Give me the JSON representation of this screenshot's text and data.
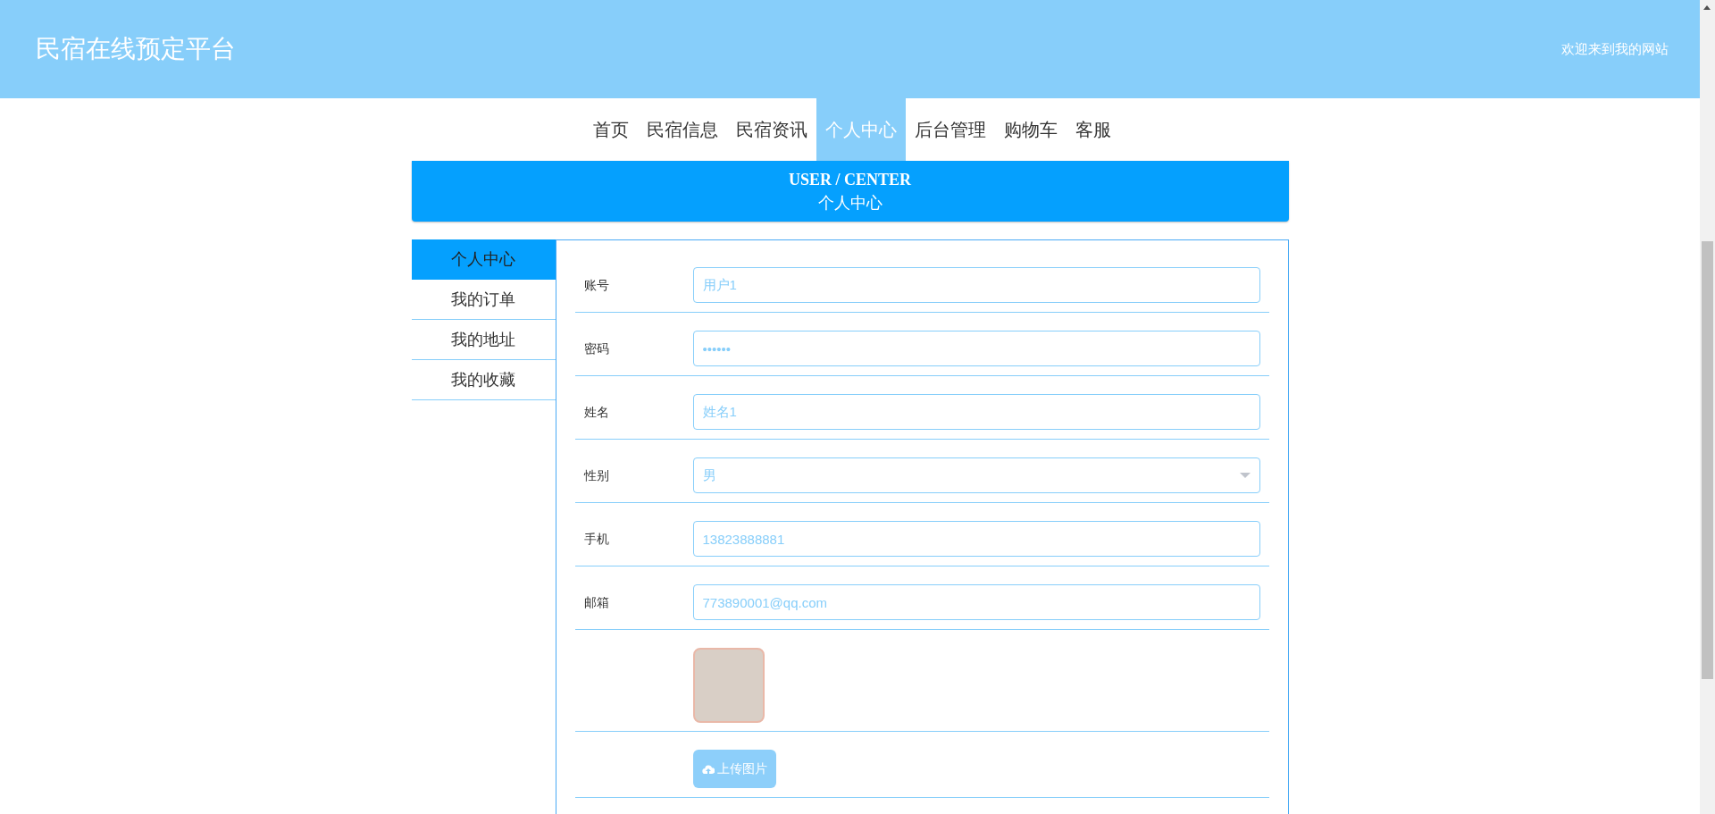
{
  "header": {
    "title": "民宿在线预定平台",
    "welcome": "欢迎来到我的网站"
  },
  "nav": [
    {
      "label": "首页",
      "selected": false
    },
    {
      "label": "民宿信息",
      "selected": false
    },
    {
      "label": "民宿资讯",
      "selected": false
    },
    {
      "label": "个人中心",
      "selected": true
    },
    {
      "label": "后台管理",
      "selected": false
    },
    {
      "label": "购物车",
      "selected": false
    },
    {
      "label": "客服",
      "selected": false
    }
  ],
  "banner": {
    "subtitle": "USER / CENTER",
    "title": "个人中心"
  },
  "sidebar": {
    "items": [
      {
        "label": "个人中心",
        "selected": true
      },
      {
        "label": "我的订单",
        "selected": false
      },
      {
        "label": "我的地址",
        "selected": false
      },
      {
        "label": "我的收藏",
        "selected": false
      }
    ]
  },
  "form": {
    "rows": [
      {
        "kind": "text",
        "label": "账号",
        "value": "用户1"
      },
      {
        "kind": "text",
        "label": "密码",
        "value": "••••••"
      },
      {
        "kind": "text",
        "label": "姓名",
        "value": "姓名1"
      },
      {
        "kind": "select",
        "label": "性别",
        "value": "男"
      },
      {
        "kind": "text",
        "label": "手机",
        "value": "13823888881"
      },
      {
        "kind": "text",
        "label": "邮箱",
        "value": "773890001@qq.com"
      },
      {
        "kind": "image"
      },
      {
        "kind": "upload",
        "label": "上传图片"
      }
    ]
  }
}
